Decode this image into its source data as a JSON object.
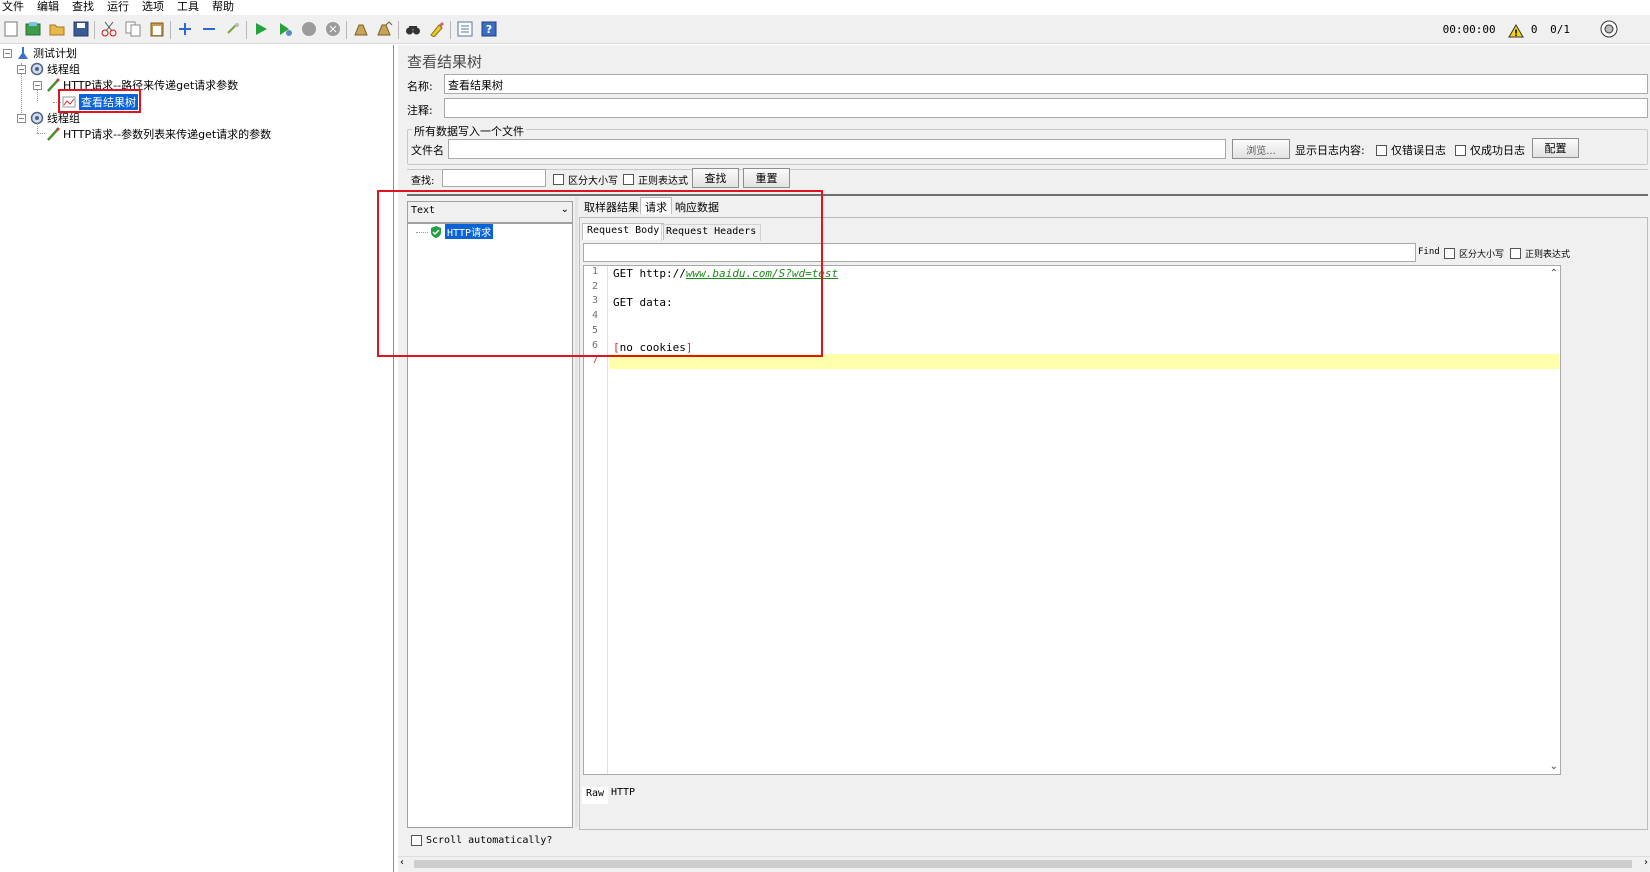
{
  "menu": [
    "文件",
    "编辑",
    "查找",
    "运行",
    "选项",
    "工具",
    "帮助"
  ],
  "toolbar": {
    "status_time": "00:00:00",
    "warning_count": "0",
    "threads": "0/1"
  },
  "tree": {
    "nodes": [
      {
        "label": "测试计划",
        "icon": "test-plan-icon"
      },
      {
        "label": "线程组",
        "icon": "thread-group-icon"
      },
      {
        "label": "HTTP请求--路径来传递get请求参数",
        "icon": "sampler-icon"
      },
      {
        "label": "查看结果树",
        "icon": "listener-icon"
      },
      {
        "label": "线程组",
        "icon": "thread-group-icon"
      },
      {
        "label": "HTTP请求--参数列表来传递get请求的参数",
        "icon": "sampler-icon"
      }
    ]
  },
  "panel": {
    "title": "查看结果树",
    "name_label": "名称:",
    "name_value": "查看结果树",
    "comment_label": "注释:",
    "comment_value": "",
    "file_group_title": "所有数据写入一个文件",
    "file_label": "文件名",
    "file_value": "",
    "browse_button": "浏览...",
    "log_content_label": "显示日志内容:",
    "errors_only": "仅错误日志",
    "success_only": "仅成功日志",
    "configure_button": "配置"
  },
  "search": {
    "label": "查找:",
    "value": "",
    "case_sensitive": "区分大小写",
    "regex": "正则表达式",
    "find_button": "查找",
    "reset_button": "重置"
  },
  "results": {
    "renderer": "Text",
    "items": [
      {
        "label": "HTTP请求",
        "status": "success"
      }
    ],
    "scroll_auto": "Scroll automatically?"
  },
  "detail": {
    "tabs": [
      "取样器结果",
      "请求",
      "响应数据"
    ],
    "active_tab": "请求",
    "sub_tabs": [
      "Request Body",
      "Request Headers"
    ],
    "find_label": "Find",
    "find_case": "区分大小写",
    "find_regex": "正则表达式",
    "code_lines": [
      {
        "n": "1",
        "text": "GET http://",
        "link": "www.baidu.com/S?wd=test"
      },
      {
        "n": "2",
        "text": ""
      },
      {
        "n": "3",
        "text": "GET data:"
      },
      {
        "n": "4",
        "text": ""
      },
      {
        "n": "5",
        "text": ""
      },
      {
        "n": "6",
        "text": "[no cookies]"
      },
      {
        "n": "7",
        "text": ""
      }
    ],
    "bottom_tabs": [
      "Raw",
      "HTTP"
    ]
  }
}
